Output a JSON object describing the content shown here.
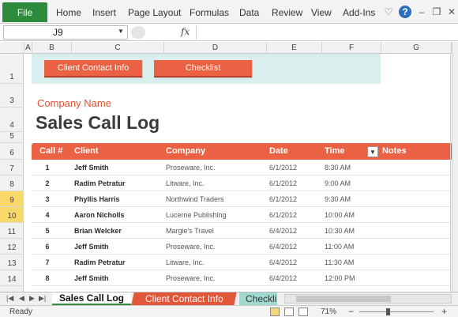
{
  "ribbon": {
    "file_label": "File",
    "tabs": [
      "Home",
      "Insert",
      "Page Layout",
      "Formulas",
      "Data",
      "Review",
      "View",
      "Add-Ins"
    ],
    "icons": [
      "heart-outline-icon",
      "help-icon",
      "minimize-ribbon-icon",
      "restore-icon",
      "close-icon"
    ]
  },
  "formula_bar": {
    "name_box": "J9",
    "fx_label": "fx",
    "formula": ""
  },
  "columns": [
    "A",
    "B",
    "C",
    "D",
    "E",
    "F",
    "G"
  ],
  "rows": [
    "1",
    "3",
    "4",
    "5",
    "6",
    "7",
    "8",
    "9",
    "10",
    "11",
    "12",
    "13",
    "14"
  ],
  "banner": {
    "btn_contact": "Client Contact Info",
    "btn_checklist": "Checklist"
  },
  "company_name": "Company Name",
  "title": "Sales Call Log",
  "table": {
    "headers": [
      "Call #",
      "Client",
      "Company",
      "Date",
      "Time",
      "Notes"
    ],
    "rows": [
      {
        "num": "1",
        "client": "Jeff Smith",
        "company": "Proseware, Inc.",
        "date": "6/1/2012",
        "time": "8:30 AM"
      },
      {
        "num": "2",
        "client": "Radim Petratur",
        "company": "Litware, Inc.",
        "date": "6/1/2012",
        "time": "9:00 AM"
      },
      {
        "num": "3",
        "client": "Phyllis Harris",
        "company": "Northwind Traders",
        "date": "6/1/2012",
        "time": "9:30 AM"
      },
      {
        "num": "4",
        "client": "Aaron Nicholls",
        "company": "Lucerne Publishing",
        "date": "6/1/2012",
        "time": "10:00 AM"
      },
      {
        "num": "5",
        "client": "Brian Welcker",
        "company": "Margie's Travel",
        "date": "6/4/2012",
        "time": "10:30 AM"
      },
      {
        "num": "6",
        "client": "Jeff Smith",
        "company": "Proseware, Inc.",
        "date": "6/4/2012",
        "time": "11:00 AM"
      },
      {
        "num": "7",
        "client": "Radim Petratur",
        "company": "Litware, Inc.",
        "date": "6/4/2012",
        "time": "11:30 AM"
      },
      {
        "num": "8",
        "client": "Jeff Smith",
        "company": "Proseware, Inc.",
        "date": "6/4/2012",
        "time": "12:00 PM"
      }
    ]
  },
  "sheet_tabs": [
    "Sales Call Log",
    "Client Contact Info",
    "Checkli"
  ],
  "status": {
    "text": "Ready",
    "zoom": "71%"
  },
  "colors": {
    "accent": "#ea6243",
    "file_tab": "#2e8a3d",
    "banner": "#dbeeee",
    "selected_row": "#fbd86a"
  }
}
